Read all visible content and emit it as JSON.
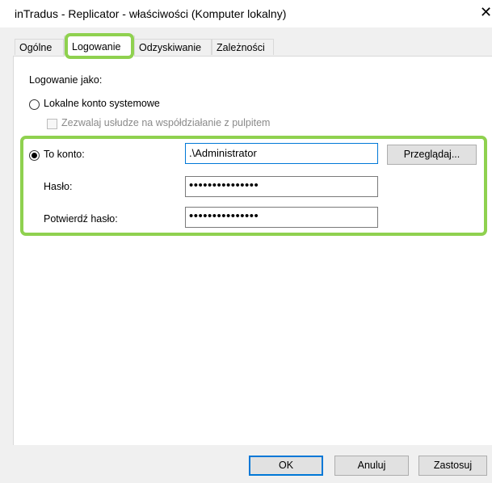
{
  "window": {
    "title": "inTradus - Replicator - właściwości (Komputer lokalny)",
    "close_glyph": "✕"
  },
  "tabs": [
    {
      "label": "Ogólne",
      "active": false
    },
    {
      "label": "Logowanie",
      "active": true
    },
    {
      "label": "Odzyskiwanie",
      "active": false
    },
    {
      "label": "Zależności",
      "active": false
    }
  ],
  "logon": {
    "logon_as_label": "Logowanie jako:",
    "local_system_label": "Lokalne konto systemowe",
    "local_system_selected": false,
    "allow_desktop_label": "Zezwalaj usłudze na współdziałanie z pulpitem",
    "allow_desktop_checked": false,
    "this_account_label": "To konto:",
    "this_account_selected": true,
    "account_value": ".\\Administrator",
    "browse_label": "Przeglądaj...",
    "password_label": "Hasło:",
    "password_value": "•••••••••••••••",
    "confirm_label": "Potwierdź hasło:",
    "confirm_value": "•••••••••••••••"
  },
  "footer": {
    "ok_label": "OK",
    "cancel_label": "Anuluj",
    "apply_label": "Zastosuj"
  },
  "colors": {
    "highlight": "#8fd14f",
    "focus_border": "#0078d7"
  }
}
